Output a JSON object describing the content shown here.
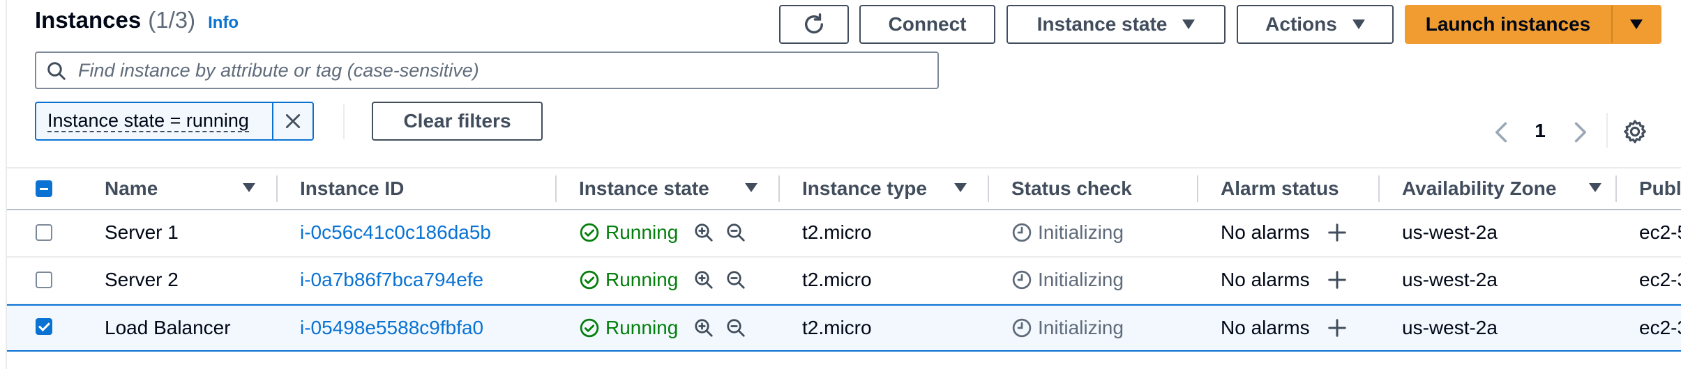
{
  "header": {
    "title": "Instances",
    "count": "(1/3)",
    "info": "Info",
    "buttons": {
      "refresh_icon": "refresh-icon",
      "connect": "Connect",
      "instance_state": "Instance state",
      "actions": "Actions",
      "launch": "Launch instances"
    }
  },
  "search": {
    "placeholder": "Find instance by attribute or tag (case-sensitive)",
    "value": ""
  },
  "filters": {
    "token": "Instance state = running",
    "clear": "Clear filters"
  },
  "pagination": {
    "page": "1"
  },
  "table": {
    "columns": [
      {
        "label": "Name",
        "sortable": true
      },
      {
        "label": "Instance ID",
        "sortable": false
      },
      {
        "label": "Instance state",
        "sortable": true
      },
      {
        "label": "Instance type",
        "sortable": true
      },
      {
        "label": "Status check",
        "sortable": false
      },
      {
        "label": "Alarm status",
        "sortable": false
      },
      {
        "label": "Availability Zone",
        "sortable": true
      },
      {
        "label": "Publ",
        "sortable": false
      }
    ],
    "rows": [
      {
        "selected": false,
        "name": "Server 1",
        "instance_id": "i-0c56c41c0c186da5b",
        "state": "Running",
        "type": "t2.micro",
        "status_check": "Initializing",
        "alarm_status": "No alarms",
        "az": "us-west-2a",
        "public": "ec2-5"
      },
      {
        "selected": false,
        "name": "Server 2",
        "instance_id": "i-0a7b86f7bca794efe",
        "state": "Running",
        "type": "t2.micro",
        "status_check": "Initializing",
        "alarm_status": "No alarms",
        "az": "us-west-2a",
        "public": "ec2-3"
      },
      {
        "selected": true,
        "name": "Load Balancer",
        "instance_id": "i-05498e5588c9fbfa0",
        "state": "Running",
        "type": "t2.micro",
        "status_check": "Initializing",
        "alarm_status": "No alarms",
        "az": "us-west-2a",
        "public": "ec2-3"
      }
    ]
  },
  "colors": {
    "accent": "#0972d3",
    "launch": "#f19c31",
    "running": "#037f0c"
  }
}
